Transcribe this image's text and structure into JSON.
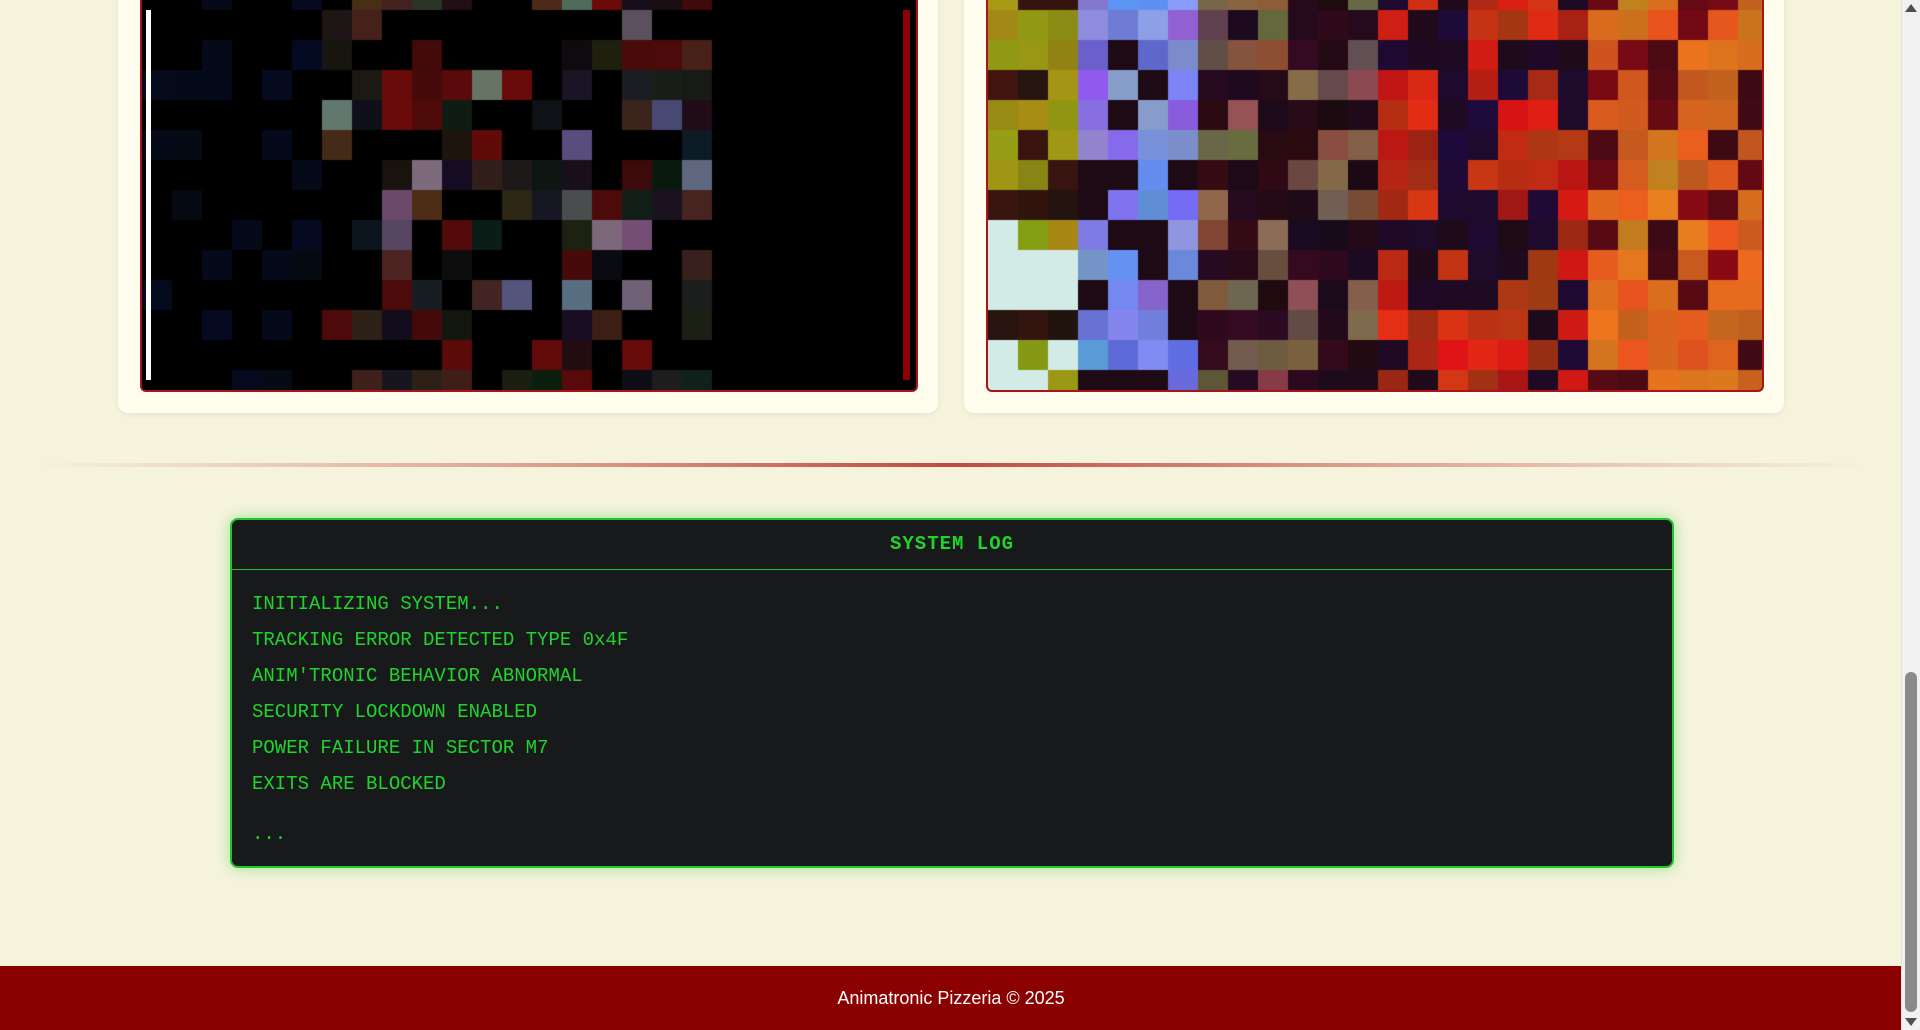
{
  "cameras": [
    {
      "name": "camera-feed-left"
    },
    {
      "name": "camera-feed-right"
    }
  ],
  "system_log": {
    "title": "SYSTEM LOG",
    "lines": [
      "INITIALIZING SYSTEM...",
      "TRACKING ERROR DETECTED TYPE 0x4F",
      "ANIM'TRONIC BEHAVIOR ABNORMAL",
      "SECURITY LOCKDOWN ENABLED",
      "POWER FAILURE IN SECTOR M7",
      "EXITS ARE BLOCKED"
    ],
    "cursor": "..."
  },
  "footer": {
    "text": "Animatronic Pizzeria © 2025"
  },
  "colors": {
    "background": "#f5f3dc",
    "accent_red": "#8b0000",
    "terminal_green": "#21d42c",
    "terminal_bg": "#17191b"
  }
}
